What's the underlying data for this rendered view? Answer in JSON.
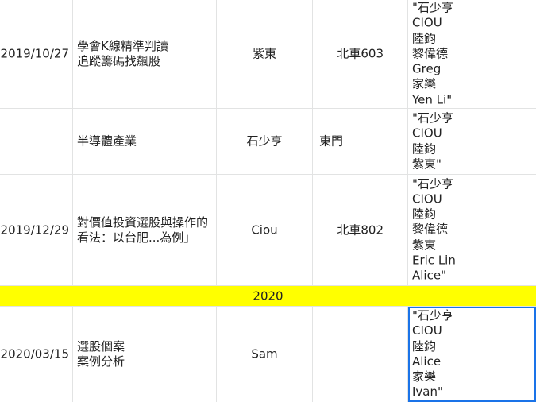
{
  "rows": [
    {
      "date": "2019/10/27",
      "topic": "學會K線精準判讀\n追蹤籌碼找飆股",
      "speaker": "紫東",
      "place": "北車603",
      "attendees": "\"石少亨\nCIOU\n陸鈞\n黎偉德\nGreg\n家樂\nYen Li\""
    },
    {
      "date": "",
      "topic": "半導體產業",
      "speaker": "石少亨",
      "place": "東門",
      "attendees": "\"石少亨\nCIOU\n陸鈞\n紫東\""
    },
    {
      "date": "2019/12/29",
      "topic": "對價值投資選股與操作的\n看法：以台肥...為例」",
      "speaker": "Ciou",
      "place": "北車802",
      "attendees": "\"石少亨\nCIOU\n陸鈞\n黎偉德\n紫東\nEric Lin\nAlice\""
    },
    {
      "date": "2020/03/15",
      "topic": "選股個案\n案例分析",
      "speaker": "Sam",
      "place": "",
      "attendees": "\"石少亨\nCIOU\n陸鈞\nAlice\n家樂\nIvan\""
    }
  ],
  "year_separator": "2020",
  "colors": {
    "year_highlight": "#ffff00",
    "selection": "#1a73e8",
    "grid": "#e2e3e3"
  }
}
